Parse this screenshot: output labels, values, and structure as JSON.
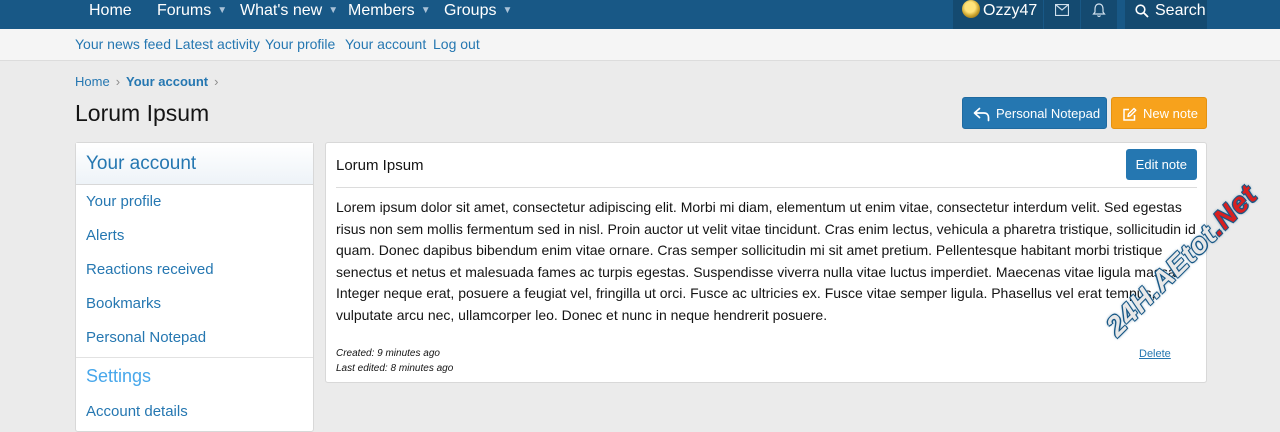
{
  "top_nav": {
    "items": [
      {
        "label": "Home",
        "has_caret": false
      },
      {
        "label": "Forums",
        "has_caret": true
      },
      {
        "label": "What's new",
        "has_caret": true
      },
      {
        "label": "Members",
        "has_caret": true
      },
      {
        "label": "Groups",
        "has_caret": true
      }
    ],
    "username": "Ozzy47",
    "search_label": "Search",
    "icons": [
      "envelope-icon",
      "bell-icon",
      "search-icon"
    ],
    "colors": {
      "bar": "#185886",
      "user_area": "#144a70"
    }
  },
  "sub_nav": {
    "items": [
      "Your news feed",
      "Latest activity",
      "Your profile",
      "Your account",
      "Log out"
    ]
  },
  "breadcrumb": {
    "home": "Home",
    "current": "Your account",
    "separator": "›"
  },
  "page_title": "Lorum Ipsum",
  "buttons": {
    "personal_notepad": "Personal Notepad",
    "new_note": "New note",
    "edit_note": "Edit note",
    "delete": "Delete"
  },
  "sidebar": {
    "header": "Your account",
    "items": [
      "Your profile",
      "Alerts",
      "Reactions received",
      "Bookmarks",
      "Personal Notepad"
    ],
    "section_title": "Settings",
    "section_items": [
      "Account details"
    ]
  },
  "note": {
    "title": "Lorum Ipsum",
    "body": "Lorem ipsum dolor sit amet, consectetur adipiscing elit. Morbi mi diam, elementum ut enim vitae, consectetur interdum velit. Sed egestas risus non sem mollis fermentum sed in nisl. Proin auctor ut velit vitae tincidunt. Cras enim lectus, vehicula a pharetra tristique, sollicitudin id quam. Donec dapibus bibendum enim vitae ornare. Cras semper sollicitudin mi sit amet pretium. Pellentesque habitant morbi tristique senectus et netus et malesuada fames ac turpis egestas. Suspendisse viverra nulla vitae luctus imperdiet. Maecenas vitae ligula massa. Integer neque erat, posuere a feugiat vel, fringilla ut orci. Fusce ac ultricies ex. Fusce vitae semper ligula. Phasellus vel erat tempus, vulputate arcu nec, ullamcorper leo. Donec et nunc in neque hendrerit posuere.",
    "created": "Created: 9 minutes ago",
    "last_edited": "Last edited: 8 minutes ago"
  },
  "watermark": {
    "part1": "24H.AEtot",
    "part2": ".Net"
  },
  "colors": {
    "link": "#2577b1",
    "accent_orange": "#f7a21c",
    "background": "#ebebeb"
  }
}
